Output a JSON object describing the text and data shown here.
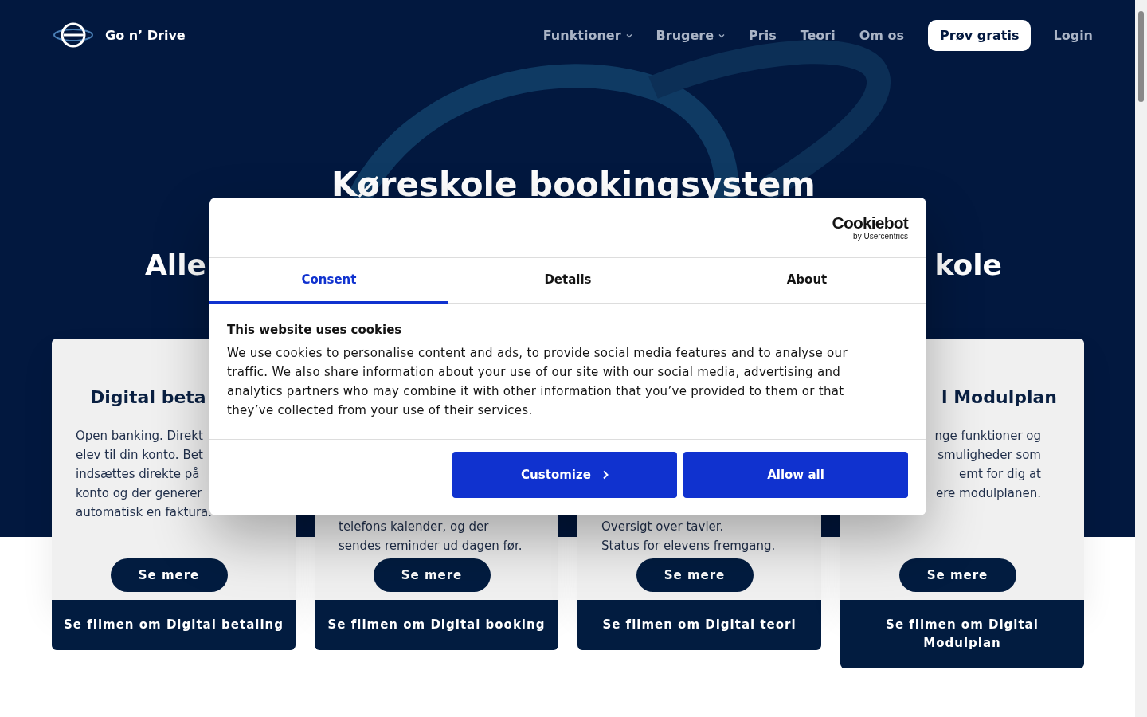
{
  "header": {
    "brand": "Go n’ Drive",
    "nav": [
      {
        "label": "Funktioner",
        "dropdown": true
      },
      {
        "label": "Brugere",
        "dropdown": true
      },
      {
        "label": "Pris",
        "dropdown": false
      },
      {
        "label": "Teori",
        "dropdown": false
      },
      {
        "label": "Om os",
        "dropdown": false
      }
    ],
    "cta": "Prøv gratis",
    "login": "Login"
  },
  "hero": {
    "title": "Køreskole bookingsystem",
    "subtitle_left": "Alle",
    "subtitle_right": "kole"
  },
  "cards": [
    {
      "title": "Digital beta",
      "text": "Open banking. Direkt\nelev til din konto. Bet\nindsættes direkte på\nkonto og der generer\nautomatisk en faktura.",
      "button": "Se mere",
      "video_link": "Se filmen om Digital betaling"
    },
    {
      "text": "telefons kalender, og der\nsendes reminder ud dagen før.",
      "button": "Se mere",
      "video_link": "Se filmen om Digital booking"
    },
    {
      "text": "Oversigt over tavler.\nStatus for elevens fremgang.",
      "button": "Se mere",
      "video_link": "Se filmen om Digital teori"
    },
    {
      "title": "l Modulplan",
      "text": "nge funktioner og\nsmuligheder som\nemt for dig at\nere modulplanen.",
      "button": "Se mere",
      "video_link": "Se filmen om Digital Modulplan"
    }
  ],
  "cookie_dialog": {
    "logo": "Cookiebot",
    "logo_sub": "by Usercentrics",
    "tabs": [
      {
        "label": "Consent",
        "selected": true
      },
      {
        "label": "Details",
        "selected": false
      },
      {
        "label": "About",
        "selected": false
      }
    ],
    "heading": "This website uses cookies",
    "body": "We use cookies to personalise content and ads, to provide social media features and to analyse our traffic. We also share information about your use of our site with our social media, advertising and analytics partners who may combine it with other information that you’ve provided to them or that they’ve collected from your use of their services.",
    "buttons": [
      {
        "label": "Customize",
        "kind": "chevron"
      },
      {
        "label": "Allow all",
        "kind": "plain"
      }
    ]
  }
}
